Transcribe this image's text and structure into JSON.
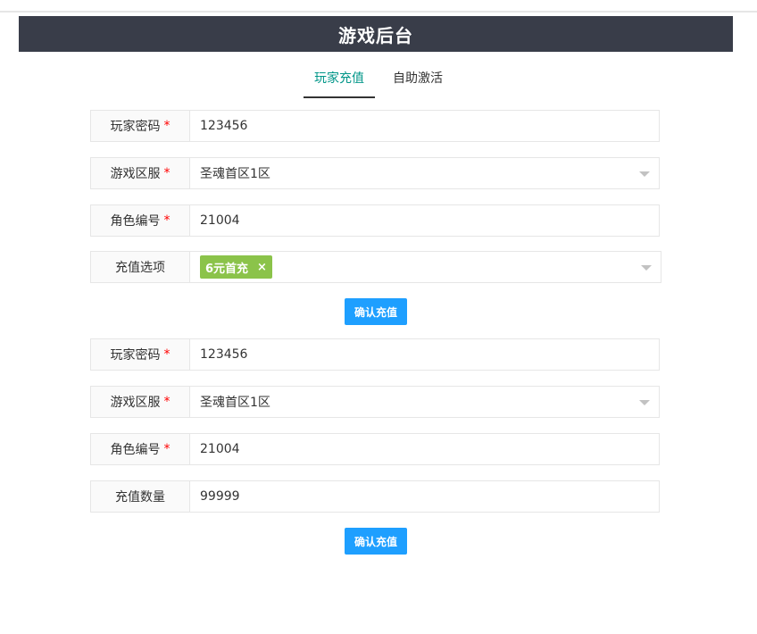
{
  "header": {
    "title": "游戏后台"
  },
  "tabs": [
    {
      "label": "玩家充值"
    },
    {
      "label": "自助激活"
    }
  ],
  "form1": {
    "password": {
      "label": "玩家密码",
      "required": "*",
      "value": "123456"
    },
    "server": {
      "label": "游戏区服",
      "required": "*",
      "value": "圣魂首区1区"
    },
    "role": {
      "label": "角色编号",
      "required": "*",
      "value": "21004"
    },
    "option": {
      "label": "充值选项",
      "tag": "6元首充",
      "tag_close": "×"
    },
    "submit_label": "确认充值"
  },
  "form2": {
    "password": {
      "label": "玩家密码",
      "required": "*",
      "value": "123456"
    },
    "server": {
      "label": "游戏区服",
      "required": "*",
      "value": "圣魂首区1区"
    },
    "role": {
      "label": "角色编号",
      "required": "*",
      "value": "21004"
    },
    "amount": {
      "label": "充值数量",
      "value": "99999"
    },
    "submit_label": "确认充值"
  },
  "colors": {
    "header_bg": "#393d49",
    "tab_active": "#009688",
    "button": "#1e9fff",
    "tag": "#8bc34a",
    "required": "#ff0000"
  }
}
